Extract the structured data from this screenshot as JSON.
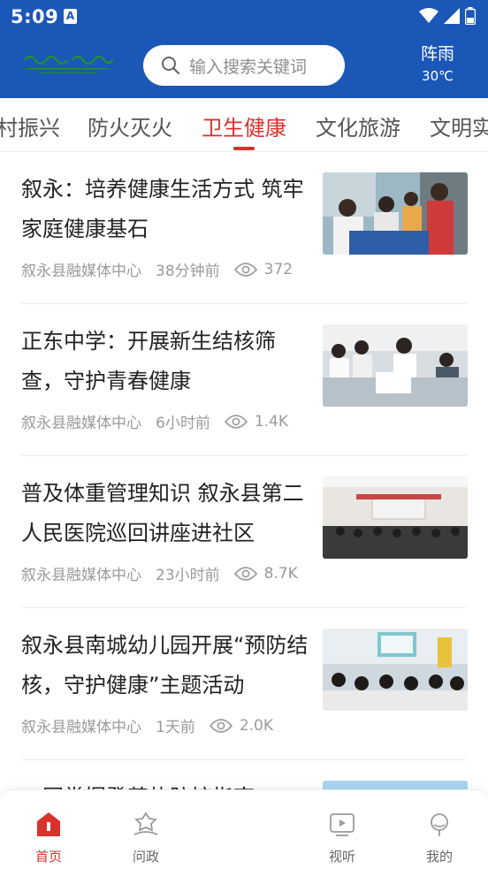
{
  "status_bar": {
    "time": "5:09",
    "notif_icon": "A"
  },
  "header": {
    "search_placeholder": "输入搜索关键词",
    "weather": {
      "condition": "阵雨",
      "temperature": "30℃"
    }
  },
  "tabs": [
    {
      "label": "村振兴",
      "active": false
    },
    {
      "label": "防火灭火",
      "active": false
    },
    {
      "label": "卫生健康",
      "active": true
    },
    {
      "label": "文化旅游",
      "active": false
    },
    {
      "label": "文明实",
      "active": false
    }
  ],
  "news": [
    {
      "title": "叙永：培养健康生活方式 筑牢家庭健康基石",
      "source": "叙永县融媒体中心",
      "time": "38分钟前",
      "views": "372"
    },
    {
      "title": "正东中学：开展新生结核筛查，守护青春健康",
      "source": "叙永县融媒体中心",
      "time": "6小时前",
      "views": "1.4K"
    },
    {
      "title": "普及体重管理知识  叙永县第二人民医院巡回讲座进社区",
      "source": "叙永县融媒体中心",
      "time": "23小时前",
      "views": "8.7K"
    },
    {
      "title": "叙永县南城幼儿园开展“预防结核，守护健康”主题活动",
      "source": "叙永县融媒体中心",
      "time": "1天前",
      "views": "2.0K"
    },
    {
      "title": "一图掌握登革热防控指南",
      "source": "",
      "time": "",
      "views": ""
    }
  ],
  "bottom_nav": [
    {
      "label": "首页",
      "icon": "home-icon",
      "active": true
    },
    {
      "label": "问政",
      "icon": "question-icon",
      "active": false
    },
    {
      "label": "视听",
      "icon": "tv-icon",
      "active": false
    },
    {
      "label": "我的",
      "icon": "profile-icon",
      "active": false
    }
  ],
  "colors": {
    "header_bg": "#1b57b7",
    "accent": "#d9322d"
  }
}
